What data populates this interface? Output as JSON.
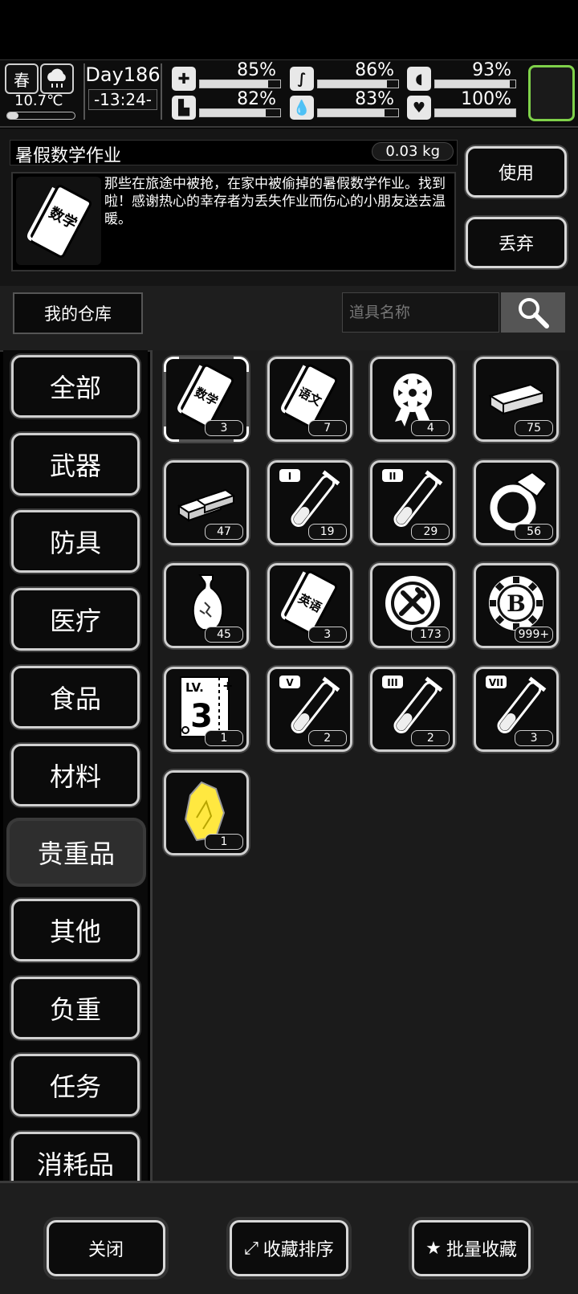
{
  "status": {
    "season": "春",
    "temperature": "10.7℃",
    "day": "Day186",
    "time": "-13:24-",
    "stats": [
      {
        "name": "health",
        "icon": "medkit-icon",
        "value": "85%",
        "level": 0.85
      },
      {
        "name": "hunger",
        "icon": "stomach-icon",
        "value": "86%",
        "level": 0.86
      },
      {
        "name": "mood",
        "icon": "pill-icon",
        "value": "93%",
        "level": 0.93
      },
      {
        "name": "stamina",
        "icon": "boot-icon",
        "value": "82%",
        "level": 0.82
      },
      {
        "name": "thirst",
        "icon": "water-drop-icon",
        "value": "83%",
        "level": 0.83
      },
      {
        "name": "heart",
        "icon": "heart-icon",
        "value": "100%",
        "level": 1.0
      }
    ]
  },
  "detail": {
    "item_name": "暑假数学作业",
    "weight": "0.03 kg",
    "description": "那些在旅途中被抢，在家中被偷掉的暑假数学作业。找到啦！感谢热心的幸存者为丢失作业而伤心的小朋友送去温暖。",
    "book_label": "数学",
    "use_label": "使用",
    "discard_label": "丢弃"
  },
  "storage": {
    "title": "我的仓库",
    "search_placeholder": "道具名称"
  },
  "categories": [
    "全部",
    "武器",
    "防具",
    "医疗",
    "食品",
    "材料",
    "贵重品",
    "其他",
    "负重",
    "任务",
    "消耗品"
  ],
  "active_category": "贵重品",
  "items": [
    {
      "kind": "book",
      "label": "数学",
      "count": "3",
      "selected": true
    },
    {
      "kind": "book",
      "label": "语文",
      "count": "7"
    },
    {
      "kind": "flower-medal",
      "count": "4"
    },
    {
      "kind": "cash",
      "count": "75"
    },
    {
      "kind": "gold-bars",
      "count": "47"
    },
    {
      "kind": "tube",
      "label": "I",
      "count": "19"
    },
    {
      "kind": "tube",
      "label": "II",
      "count": "29"
    },
    {
      "kind": "ring",
      "count": "56"
    },
    {
      "kind": "vase",
      "count": "45"
    },
    {
      "kind": "book",
      "label": "英语",
      "count": "3"
    },
    {
      "kind": "coin-tool",
      "count": "173"
    },
    {
      "kind": "coin-b",
      "count": "999+"
    },
    {
      "kind": "level-ticket",
      "label": "LV.",
      "count": "1"
    },
    {
      "kind": "tube",
      "label": "V",
      "count": "2"
    },
    {
      "kind": "tube",
      "label": "III",
      "count": "2"
    },
    {
      "kind": "tube",
      "label": "VII",
      "count": "3"
    },
    {
      "kind": "yellow-crystal",
      "count": "1"
    }
  ],
  "bottom": {
    "close_label": "关闭",
    "sort_label": "收藏排序",
    "batch_label": "批量收藏"
  }
}
